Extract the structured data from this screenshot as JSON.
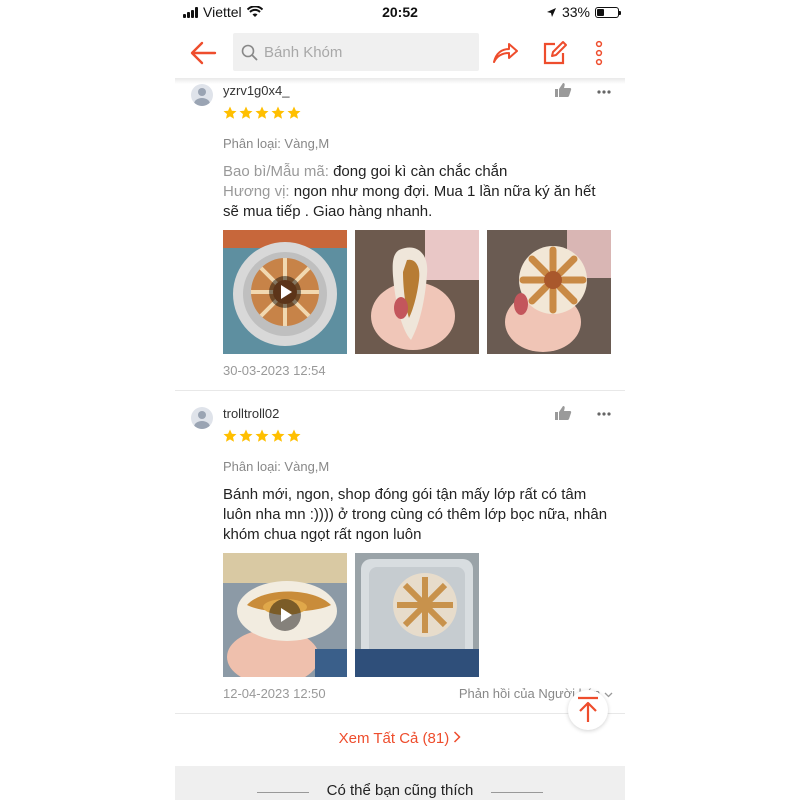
{
  "status_bar": {
    "carrier": "Viettel",
    "time": "20:52",
    "battery": "33%",
    "battery_level": 0.33
  },
  "header": {
    "search_placeholder": "Bánh Khóm",
    "icons": [
      "back-arrow-icon",
      "search-icon",
      "share-icon",
      "edit-icon",
      "more-vertical-icon"
    ]
  },
  "colors": {
    "accent": "#ee4d2d",
    "star": "#ffbf00",
    "muted": "#999999"
  },
  "reviews": [
    {
      "username": "yzrv1g0x4_",
      "rating": 5,
      "variant": "Phân loại: Vàng,M",
      "packaging_label": "Bao bì/Mẫu mã: ",
      "packaging_value": "đong goi kì càn chắc chắn",
      "taste_label": "Hương vị: ",
      "taste_value": "ngon như mong đợi. Mua 1 lần nữa ký ăn hết sẽ mua tiếp . Giao hàng nhanh.",
      "media_count": 3,
      "date": "30-03-2023 12:54"
    },
    {
      "username": "trolltroll02",
      "rating": 5,
      "variant": "Phân loại: Vàng,M",
      "text": "Bánh mới, ngon, shop đóng gói tận mấy lớp rất có tâm luôn nha mn :)))) ở trong cùng có thêm lớp bọc nữa, nhân khóm chua ngọt rất ngon luôn",
      "media_count": 2,
      "date": "12-04-2023 12:50",
      "seller_reply": "Phản hồi của Người bán"
    }
  ],
  "see_all": "Xem Tất Cả (81)",
  "suggestions_title": "Có thể bạn cũng thích"
}
